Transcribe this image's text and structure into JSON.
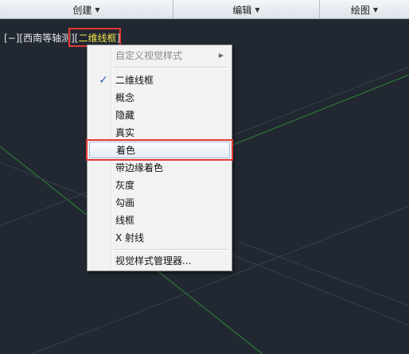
{
  "ribbon": {
    "panels": [
      {
        "label": "创建"
      },
      {
        "label": "编辑"
      },
      {
        "label": "绘图"
      }
    ]
  },
  "viewport": {
    "controls": "[−][西南等轴测][",
    "visual_style": "二维线框",
    "close": "]"
  },
  "menu": {
    "header": "自定义视觉样式",
    "checked_index": 0,
    "styles": [
      "二维线框",
      "概念",
      "隐藏",
      "真实",
      "着色",
      "带边缘着色",
      "灰度",
      "勾画",
      "线框",
      "X 射线"
    ],
    "manager": "视觉样式管理器..."
  },
  "colors": {
    "highlight": "#e53935",
    "visual_style_text": "#f0e24a",
    "grid_line": "#2f9a38"
  }
}
